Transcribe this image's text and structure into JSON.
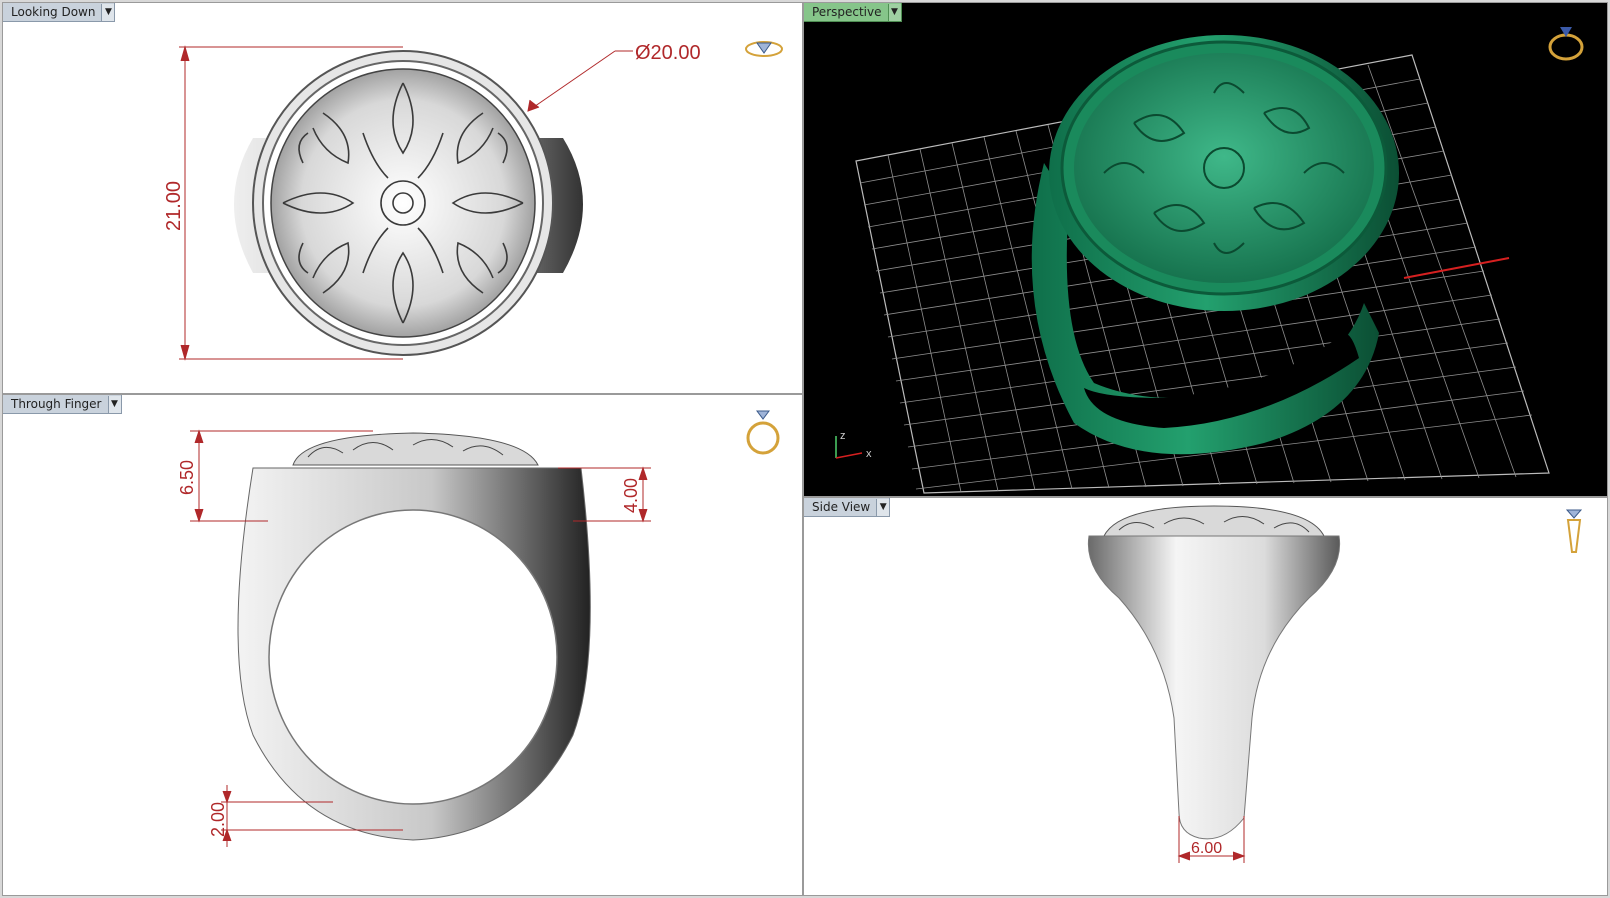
{
  "viewports": {
    "top_left": {
      "title": "Looking Down"
    },
    "top_right": {
      "title": "Perspective"
    },
    "bottom_left": {
      "title": "Through Finger"
    },
    "bottom_right": {
      "title": "Side View"
    }
  },
  "dimensions": {
    "diameter": "Ø20.00",
    "height_top": "21.00",
    "head_height": "6.50",
    "shoulder_height": "4.00",
    "shank_bottom": "2.00",
    "side_width": "6.00"
  },
  "axis": {
    "x": "x",
    "z": "z"
  },
  "colors": {
    "dimension_line": "#b0282a",
    "ring_perspective": "#1f8f62",
    "viewport_bg_perspective": "#000000",
    "grid": "#9a9a9a"
  },
  "icons": [
    "ring-diamond-icon",
    "ring-perspective-icon",
    "ring-front-icon",
    "ring-side-icon",
    "dropdown-arrow-icon"
  ]
}
